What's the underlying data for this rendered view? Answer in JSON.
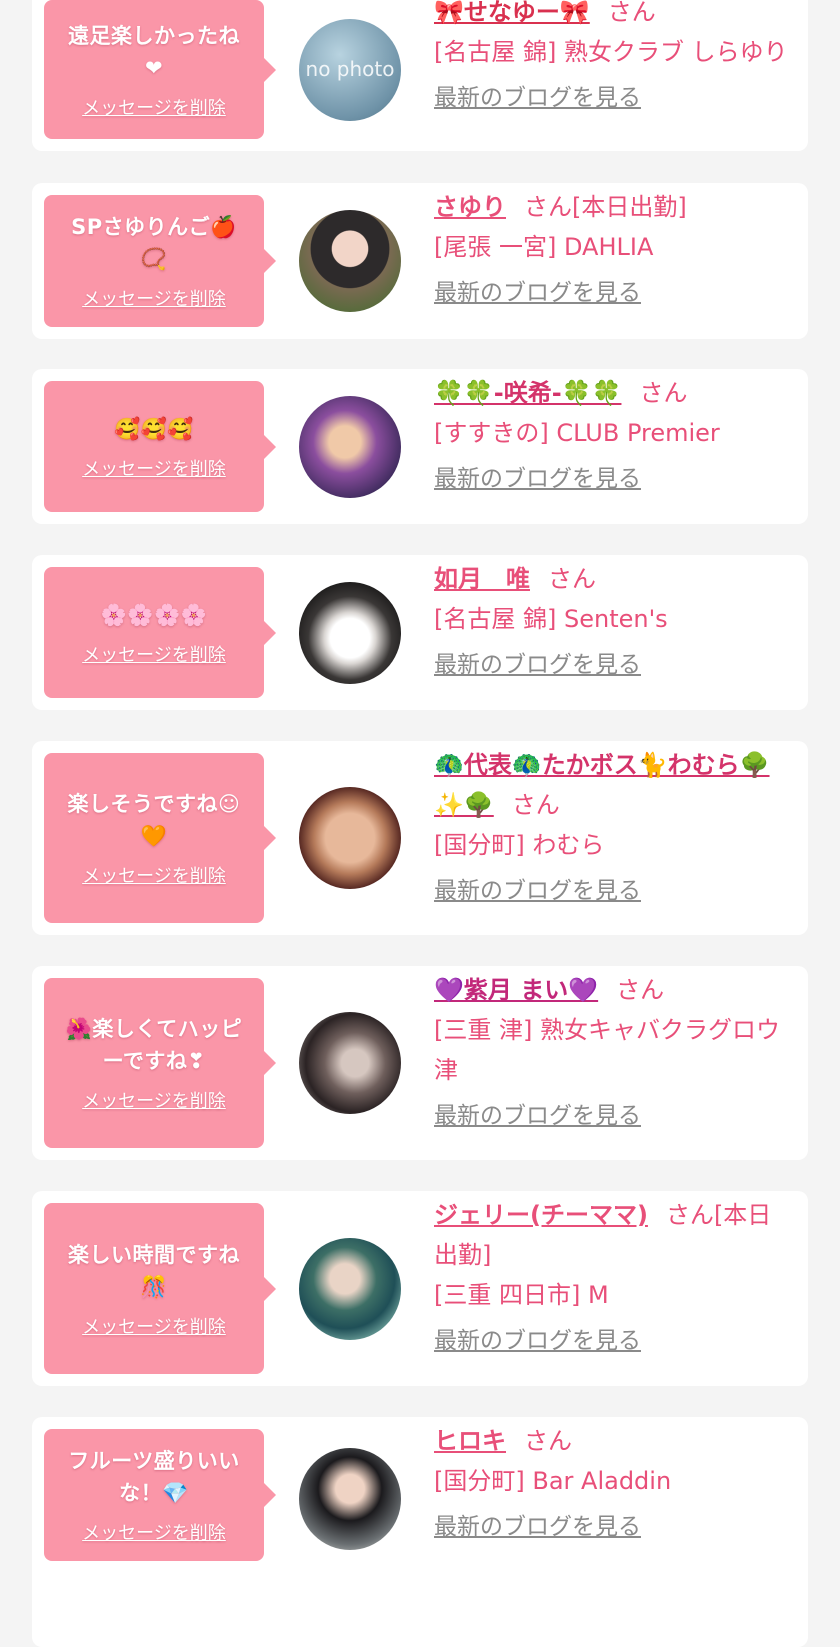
{
  "delete_label": "メッセージを削除",
  "blog_label": "最新のブログを見る",
  "honorific": "さん",
  "colors": {
    "bubble": "#fa96a8",
    "accent": "#e84f79",
    "muted": "#8a8a8a"
  },
  "entries": [
    {
      "message": "遠足楽しかったね\n❤",
      "name": "🎀せなゆー🎀",
      "suffix": "",
      "shop": "[名古屋 錦] 熟女クラブ しらゆり",
      "avatar_text": "no photo",
      "name_color": "#d9314f"
    },
    {
      "message": "SPさゆりんご🍎\n📿",
      "name": "さゆり",
      "suffix": "[本日出勤]",
      "shop": "[尾張 一宮] DAHLIA",
      "avatar_text": "",
      "name_color": "#e84f79"
    },
    {
      "message": "🥰🥰🥰",
      "name": "🍀🍀-咲希-🍀🍀",
      "suffix": "",
      "shop": "[すすきの] CLUB Premier",
      "avatar_text": "",
      "name_color": "#e84f79"
    },
    {
      "message": "🌸🌸🌸🌸",
      "name": "如月　唯",
      "suffix": "",
      "shop": "[名古屋 錦] Senten's",
      "avatar_text": "",
      "name_color": "#e84f79"
    },
    {
      "message": "楽しそうですね☺\n🧡",
      "name": "🦚代表🦚たかボス🐈わむら🌳✨🌳",
      "suffix": "",
      "shop": "[国分町] わむら",
      "avatar_text": "",
      "name_color": "#e84f79"
    },
    {
      "message": "🌺楽しくてハッピ\nーですね❣",
      "name": "💜紫月 まい💜",
      "suffix": "",
      "shop": "[三重 津] 熟女キャバクラグロウ津",
      "avatar_text": "",
      "name_color": "#e84f79"
    },
    {
      "message": "楽しい時間ですね\n🎊",
      "name": "ジェリー(チーママ)",
      "suffix": "[本日出勤]",
      "shop": "[三重 四日市] M",
      "avatar_text": "",
      "name_color": "#e84f79"
    },
    {
      "message": "フルーツ盛りいい\nな！💎",
      "name": "ヒロキ",
      "suffix": "",
      "shop": "[国分町] Bar Aladdin",
      "avatar_text": "",
      "name_color": "#e84f79"
    }
  ]
}
